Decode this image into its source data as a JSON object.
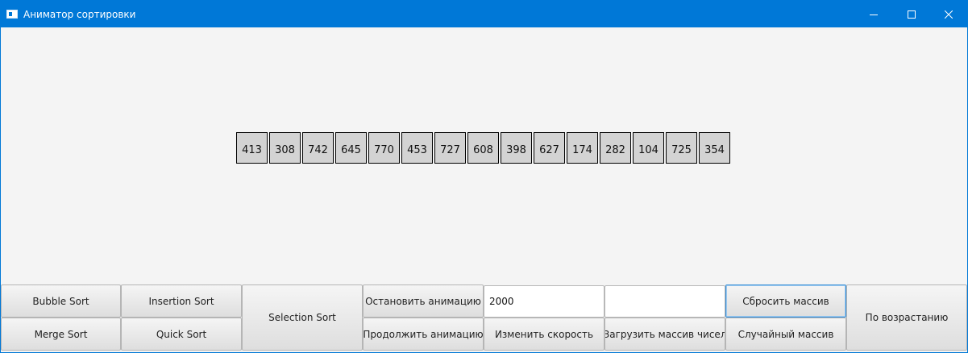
{
  "window": {
    "title": "Аниматор сортировки",
    "icon": "app-window-icon",
    "controls": [
      "minimize-icon",
      "maximize-icon",
      "close-icon"
    ]
  },
  "array": {
    "values": [
      "413",
      "308",
      "742",
      "645",
      "770",
      "453",
      "727",
      "608",
      "398",
      "627",
      "174",
      "282",
      "104",
      "725",
      "354"
    ]
  },
  "toolbar": {
    "bubble_sort": "Bubble Sort",
    "merge_sort": "Merge Sort",
    "insertion_sort": "Insertion Sort",
    "quick_sort": "Quick Sort",
    "selection_sort": "Selection Sort",
    "stop_animation": "Остановить анимацию",
    "resume_animation": "Продолжить анимацию",
    "speed_value": "2000",
    "change_speed": "Изменить скорость",
    "array_input_value": "",
    "load_array": "Загрузить массив чисел",
    "reset_array": "Сбросить массив",
    "random_array": "Случайный массив",
    "ascending": "По возрастанию"
  },
  "colors": {
    "title_bar": "#0078d7",
    "background": "#f4f4f4",
    "cell_fill": "#d3d3d3",
    "focus_border": "#3a8fd6"
  }
}
